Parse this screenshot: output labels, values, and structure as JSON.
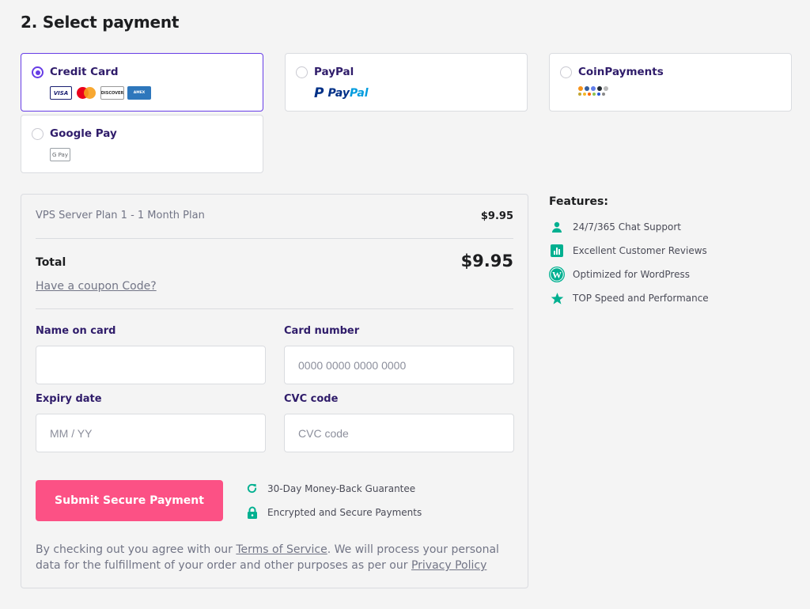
{
  "heading": "2. Select payment",
  "payment_methods": [
    {
      "label": "Credit Card",
      "selected": true
    },
    {
      "label": "PayPal",
      "selected": false
    },
    {
      "label": "CoinPayments",
      "selected": false
    },
    {
      "label": "Google Pay",
      "selected": false
    }
  ],
  "card_brands": [
    "VISA",
    "Mastercard",
    "DISCOVER",
    "AMERICAN EXPRESS"
  ],
  "paypal_logo": {
    "text1": "Pay",
    "text2": "Pal"
  },
  "gpay_logo": "G Pay",
  "order": {
    "plan_name": "VPS Server Plan 1 - 1 Month Plan",
    "plan_price": "$9.95",
    "total_label": "Total",
    "total_price": "$9.95",
    "coupon_link": "Have a coupon Code?"
  },
  "form": {
    "name_label": "Name on card",
    "name_value": "",
    "card_label": "Card number",
    "card_placeholder": "0000 0000 0000 0000",
    "expiry_label": "Expiry date",
    "expiry_placeholder": "MM / YY",
    "cvc_label": "CVC code",
    "cvc_placeholder": "CVC code"
  },
  "submit_label": "Submit Secure Payment",
  "guarantees": [
    {
      "icon": "refresh-icon",
      "text": "30-Day Money-Back Guarantee"
    },
    {
      "icon": "lock-icon",
      "text": "Encrypted and Secure Payments"
    }
  ],
  "terms": {
    "part1": "By checking out you agree with our ",
    "tos": "Terms of Service",
    "part2": ". We will process your personal data for the fulfillment of your order and other purposes as per our ",
    "privacy": "Privacy Policy"
  },
  "features": {
    "title": "Features:",
    "items": [
      {
        "icon": "user-icon",
        "text": "24/7/365 Chat Support"
      },
      {
        "icon": "chart-icon",
        "text": "Excellent Customer Reviews"
      },
      {
        "icon": "wordpress-icon",
        "text": "Optimized for WordPress"
      },
      {
        "icon": "star-icon",
        "text": "TOP Speed and Performance"
      }
    ]
  },
  "colors": {
    "accent": "#673de6",
    "submit": "#fc5185",
    "feature_icon": "#00b090",
    "text_dark": "#2f1c6a"
  }
}
